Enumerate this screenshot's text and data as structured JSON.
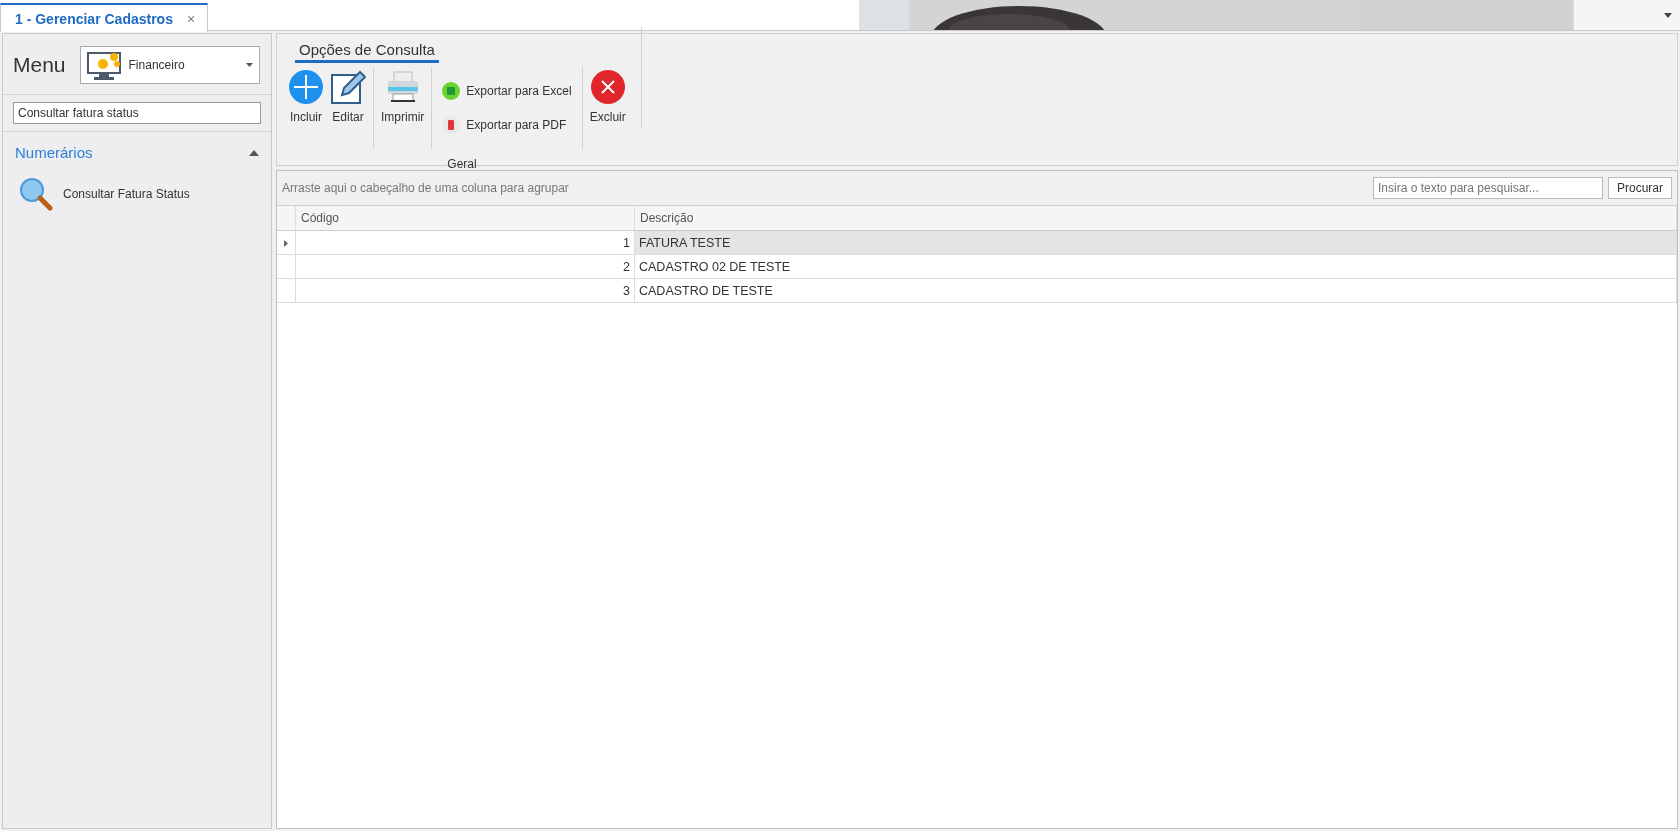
{
  "tabs": [
    {
      "label": "1 - Gerenciar Cadastros",
      "selected": true,
      "close": "×"
    }
  ],
  "menu": {
    "title": "Menu",
    "module": "Financeiro",
    "filter_value": "Consultar fatura status",
    "group": {
      "title": "Numerários",
      "expanded": true,
      "items": [
        {
          "label": "Consultar Fatura Status"
        }
      ]
    }
  },
  "ribbon": {
    "tab": "Opções de Consulta",
    "group_label": "Geral",
    "buttons": [
      {
        "kind": "add",
        "label": "Incluir"
      },
      {
        "kind": "edit",
        "label": "Editar"
      },
      {
        "kind": "print",
        "label": "Imprimir"
      },
      {
        "kind": "exports",
        "items": [
          {
            "kind": "excel",
            "label": "Exportar para Excel"
          },
          {
            "kind": "pdf",
            "label": "Exportar para PDF"
          }
        ]
      },
      {
        "kind": "delete",
        "label": "Excluir"
      }
    ]
  },
  "grid": {
    "group_hint": "Arraste aqui o cabeçalho de uma coluna para agrupar",
    "search_placeholder": "Insira o texto para pesquisar...",
    "search_button": "Procurar",
    "columns": [
      "Código",
      "Descrição"
    ],
    "rows": [
      {
        "cells": [
          "1",
          "FATURA TESTE"
        ],
        "selected": true
      },
      {
        "cells": [
          "2",
          "CADASTRO 02 DE TESTE"
        ],
        "selected": false
      },
      {
        "cells": [
          "3",
          "CADASTRO DE TESTE"
        ],
        "selected": false
      }
    ]
  }
}
